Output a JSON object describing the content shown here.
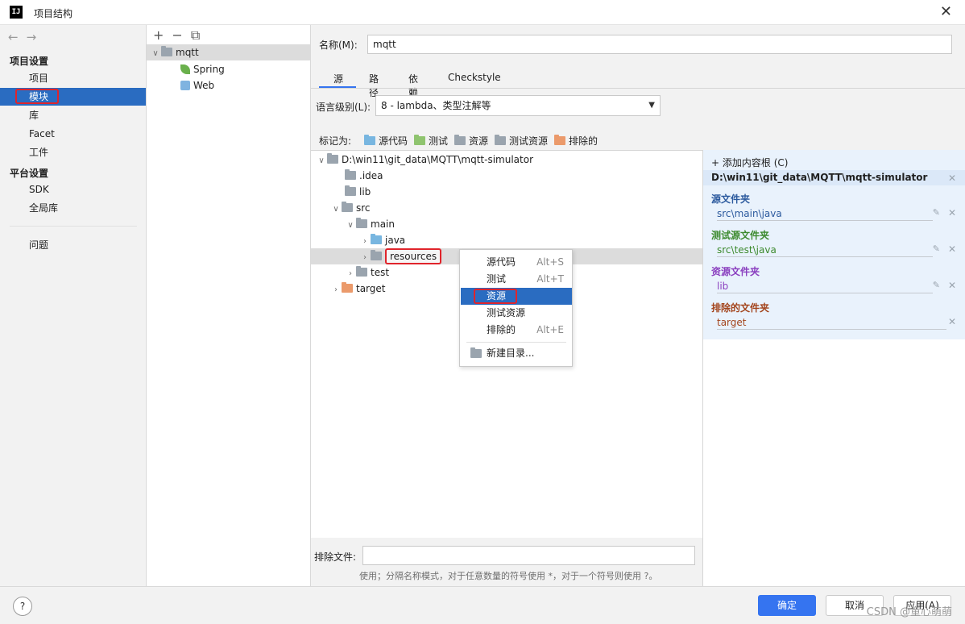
{
  "window": {
    "title": "项目结构",
    "app_icon_text": "IJ"
  },
  "nav": {
    "project_settings_heading": "项目设置",
    "project_settings_items": [
      "项目",
      "模块",
      "库",
      "Facet",
      "工件"
    ],
    "platform_settings_heading": "平台设置",
    "platform_settings_items": [
      "SDK",
      "全局库"
    ],
    "other_items": [
      "问题"
    ],
    "selected": "模块"
  },
  "modules": {
    "root": "mqtt",
    "facets": [
      "Spring",
      "Web"
    ]
  },
  "module_detail": {
    "name_label": "名称(M):",
    "name_value": "mqtt",
    "tabs": [
      "源",
      "路径",
      "依赖",
      "Checkstyle"
    ],
    "active_tab": "源",
    "language_level_label": "语言级别(L):",
    "language_level_value": "8 - lambda、类型注解等",
    "mark_as_label": "标记为:",
    "mark_as_buttons": [
      "源代码",
      "测试",
      "资源",
      "测试资源",
      "排除的"
    ]
  },
  "content_tree": {
    "root": "D:\\win11\\git_data\\MQTT\\mqtt-simulator",
    "idea": ".idea",
    "lib": "lib",
    "src": "src",
    "main": "main",
    "java": "java",
    "resources": "resources",
    "test": "test",
    "target": "target"
  },
  "context_menu": {
    "items": [
      {
        "label": "源代码",
        "shortcut": "Alt+S"
      },
      {
        "label": "测试",
        "shortcut": "Alt+T"
      },
      {
        "label": "资源",
        "shortcut": ""
      },
      {
        "label": "测试资源",
        "shortcut": ""
      },
      {
        "label": "排除的",
        "shortcut": "Alt+E"
      },
      {
        "label": "新建目录...",
        "shortcut": ""
      }
    ],
    "selected": "资源"
  },
  "content_roots": {
    "add_label": "添加内容根 (C)",
    "root_path": "D:\\win11\\git_data\\MQTT\\mqtt-simulator",
    "sections": [
      {
        "heading": "源文件夹",
        "entries": [
          "src\\main\\java"
        ],
        "color": "#2c5a9e"
      },
      {
        "heading": "测试源文件夹",
        "entries": [
          "src\\test\\java"
        ],
        "color": "#3d8a2e"
      },
      {
        "heading": "资源文件夹",
        "entries": [
          "lib"
        ],
        "color": "#8a3fbf"
      },
      {
        "heading": "排除的文件夹",
        "entries": [
          "target"
        ],
        "color": "#a3441c"
      }
    ]
  },
  "exclude_files": {
    "label": "排除文件:",
    "value": "",
    "hint": "使用；分隔名称模式，对于任意数量的符号使用 *，对于一个符号则使用 ?。"
  },
  "footer": {
    "help": "?",
    "ok": "确定",
    "cancel": "取消",
    "apply": "应用(A)",
    "watermark": "CSDN @童心萌萌"
  },
  "colors": {
    "accent": "#3574f0",
    "selection": "#2a6cc1",
    "highlight_box": "#e0242b"
  }
}
